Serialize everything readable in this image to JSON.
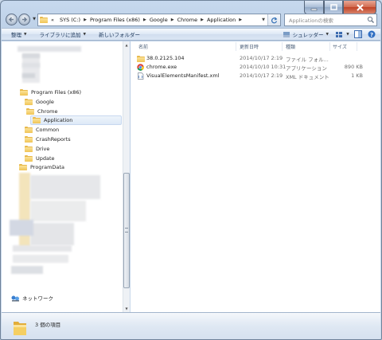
{
  "address": {
    "crumbs": [
      "SYS (C:)",
      "Program Files (x86)",
      "Google",
      "Chrome",
      "Application"
    ],
    "overflow": "«"
  },
  "search": {
    "placeholder": "Applicationの検索"
  },
  "toolbar": {
    "organize": "整理",
    "include_library": "ライブラリに追加",
    "new_folder": "新しいフォルダー",
    "shredder": "シュレッダー"
  },
  "tree": {
    "items": [
      {
        "label": "Program Files (x86)"
      },
      {
        "label": "Google"
      },
      {
        "label": "Chrome"
      },
      {
        "label": "Application"
      },
      {
        "label": "Common"
      },
      {
        "label": "CrashReports"
      },
      {
        "label": "Drive"
      },
      {
        "label": "Update"
      },
      {
        "label": "ProgramData"
      }
    ],
    "network": "ネットワーク"
  },
  "columns": {
    "name": "名前",
    "date": "更新日時",
    "type": "種類",
    "size": "サイズ"
  },
  "files": [
    {
      "name": "38.0.2125.104",
      "date": "2014/10/17 2:19",
      "type": "ファイル フォル...",
      "size": "",
      "icon": "folder-icon"
    },
    {
      "name": "chrome.exe",
      "date": "2014/10/10 10:31",
      "type": "アプリケーション",
      "size": "890 KB",
      "icon": "chrome-icon"
    },
    {
      "name": "VisualElementsManifest.xml",
      "date": "2014/10/17 2:19",
      "type": "XML ドキュメント",
      "size": "1 KB",
      "icon": "xml-file-icon"
    }
  ],
  "status": {
    "count": "3 個の項目"
  },
  "colors": {
    "folder": "#f0c455",
    "chrome_red": "#db4437",
    "chrome_yellow": "#f4c20d",
    "chrome_green": "#0f9d58",
    "chrome_blue": "#4285f4"
  }
}
